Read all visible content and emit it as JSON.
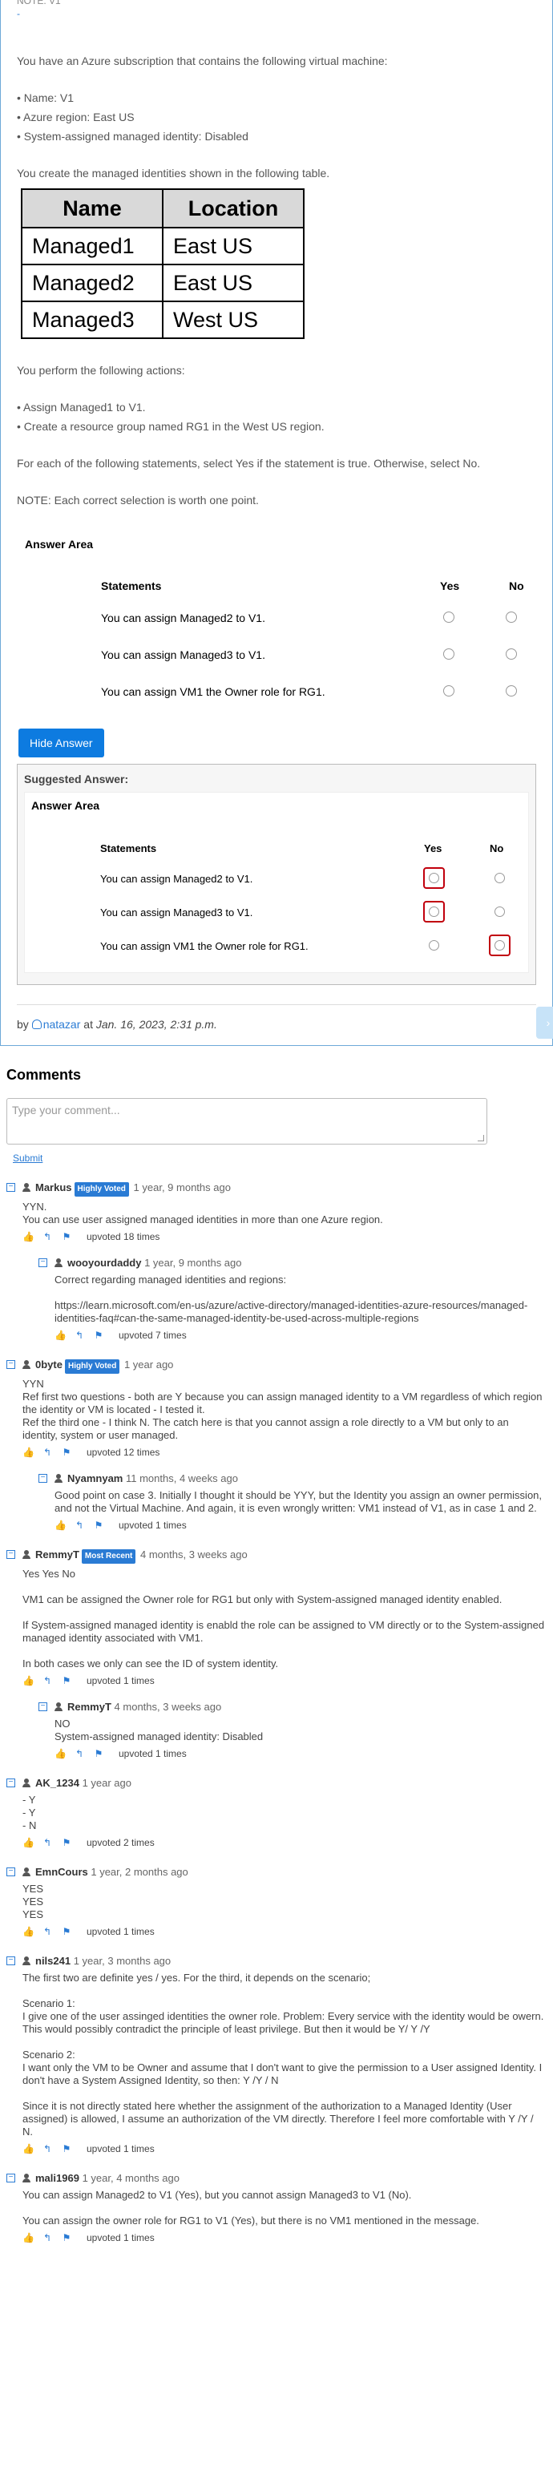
{
  "question": {
    "top_label": "NOTE: V1",
    "top_dash": "-",
    "intro": "You have an Azure subscription that contains the following virtual machine:",
    "vm_props": [
      "• Name: V1",
      "• Azure region: East US",
      "• System-assigned managed identity: Disabled"
    ],
    "table_intro": "You create the managed identities shown in the following table.",
    "table": {
      "headers": [
        "Name",
        "Location"
      ],
      "rows": [
        [
          "Managed1",
          "East US"
        ],
        [
          "Managed2",
          "East US"
        ],
        [
          "Managed3",
          "West US"
        ]
      ]
    },
    "actions_intro": "You perform the following actions:",
    "actions": [
      "• Assign Managed1 to V1.",
      "• Create a resource group named RG1 in the West US region."
    ],
    "instruction": "For each of the following statements, select Yes if the statement is true. Otherwise, select No.",
    "note": "NOTE: Each correct selection is worth one point.",
    "answer_area": {
      "title": "Answer Area",
      "col_statements": "Statements",
      "col_yes": "Yes",
      "col_no": "No",
      "statements": [
        "You can assign Managed2 to V1.",
        "You can assign Managed3 to V1.",
        "You can assign VM1 the Owner role for RG1."
      ]
    },
    "hide_answer_label": "Hide Answer",
    "suggested": {
      "title": "Suggested Answer:",
      "area_title": "Answer Area",
      "col_statements": "Statements",
      "col_yes": "Yes",
      "col_no": "No",
      "statements": [
        "You can assign Managed2 to V1.",
        "You can assign Managed3 to V1.",
        "You can assign VM1 the Owner role for RG1."
      ],
      "selected": [
        "Yes",
        "Yes",
        "No"
      ]
    },
    "byline": {
      "by": "by",
      "author": "natazar",
      "at": "at",
      "date": "Jan. 16, 2023, 2:31 p.m."
    }
  },
  "comments_title": "Comments",
  "comment_input": {
    "placeholder": "Type your comment...",
    "submit_label": "Submit"
  },
  "comments": [
    {
      "user": "Markus",
      "badge": "Highly Voted",
      "badge_type": "hv",
      "time": "1 year, 9 months ago",
      "body": "YYN.\nYou can use user assigned managed identities in more than one Azure region.",
      "upvotes": "upvoted 18 times",
      "replies": [
        {
          "user": "wooyourdaddy",
          "time": "1 year, 9 months ago",
          "body": "Correct regarding managed identities and regions:\n\nhttps://learn.microsoft.com/en-us/azure/active-directory/managed-identities-azure-resources/managed-identities-faq#can-the-same-managed-identity-be-used-across-multiple-regions",
          "upvotes": "upvoted 7 times"
        }
      ]
    },
    {
      "user": "0byte",
      "badge": "Highly Voted",
      "badge_type": "hv",
      "time": "1 year ago",
      "body": "YYN\nRef first two questions - both are Y because you can assign managed identity to a VM regardless of which region the identity or VM is located - I tested it.\nRef the third one - I think N. The catch here is that you cannot assign a role directly to a VM but only to an identity, system or user managed.",
      "upvotes": "upvoted 12 times",
      "replies": [
        {
          "user": "Nyamnyam",
          "time": "11 months, 4 weeks ago",
          "body": "Good point on case 3. Initially I thought it should be YYY, but the Identity you assign an owner permission, and not the Virtual Machine. And again, it is even wrongly written: VM1 instead of V1, as in case 1 and 2.",
          "upvotes": "upvoted 1 times"
        }
      ]
    },
    {
      "user": "RemmyT",
      "badge": "Most Recent",
      "badge_type": "mr",
      "time": "4 months, 3 weeks ago",
      "body": "Yes Yes No\n\nVM1 can be assigned the Owner role for RG1 but only with System-assigned managed identity enabled.\n\nIf System-assigned managed identity is enabld the role can be assigned to VM directly or to the System-assigned managed identity associated with VM1.\n\nIn both cases we only can see the ID of system identity.",
      "upvotes": "upvoted 1 times",
      "replies": [
        {
          "user": "RemmyT",
          "time": "4 months, 3 weeks ago",
          "body": "NO\nSystem-assigned managed identity: Disabled",
          "upvotes": "upvoted 1 times"
        }
      ]
    },
    {
      "user": "AK_1234",
      "time": "1 year ago",
      "body": "- Y\n- Y\n- N",
      "upvotes": "upvoted 2 times",
      "replies": []
    },
    {
      "user": "EmnCours",
      "time": "1 year, 2 months ago",
      "body": "YES\nYES\nYES",
      "upvotes": "upvoted 1 times",
      "replies": []
    },
    {
      "user": "nils241",
      "time": "1 year, 3 months ago",
      "body": "The first two are definite yes / yes. For the third, it depends on the scenario;\n\nScenario 1:\nI give one of the user assinged identities the owner role. Problem: Every service with the identity would be owern. This would possibly contradict the principle of least privilege. But then it would be Y/ Y /Y\n\nScenario 2:\nI want only the VM to be Owner and assume that I don't want to give the permission to a User assigned Identity. I don't have a System Assigned Identity, so then: Y /Y / N\n\nSince it is not directly stated here whether the assignment of the authorization to a Managed Identity (User assigned) is allowed, I assume an authorization of the VM directly. Therefore I feel more comfortable with Y /Y / N.",
      "upvotes": "upvoted 1 times",
      "replies": []
    },
    {
      "user": "mali1969",
      "time": "1 year, 4 months ago",
      "body": "You can assign Managed2 to V1 (Yes), but you cannot assign Managed3 to V1 (No).\n\nYou can assign the owner role for RG1 to V1 (Yes), but there is no VM1 mentioned in the message.",
      "upvotes": "upvoted 1 times",
      "replies": []
    }
  ]
}
